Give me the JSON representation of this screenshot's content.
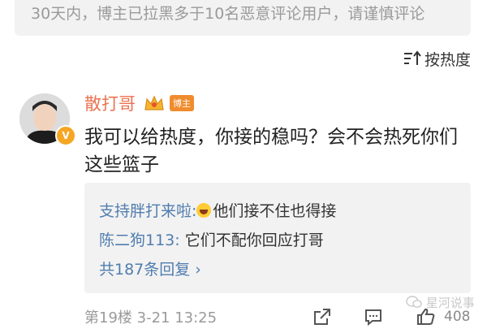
{
  "notice": {
    "text": "30天内，博主已拉黑多于10名恶意评论用户，请谨慎评论"
  },
  "sort": {
    "label": "按热度"
  },
  "comment": {
    "username": "散打哥",
    "tag": "博主",
    "text": "我可以给热度，你接的稳吗？会不会热死你们这些篮子",
    "floor": "第19楼",
    "time": "3-21 13:25",
    "likes": "408"
  },
  "replies": [
    {
      "name": "支持胖打来啦:",
      "text": "他们接不住也得接"
    },
    {
      "name": "陈二狗113:",
      "text": " 它们不配你回应打哥"
    }
  ],
  "replies_more": "共187条回复 ›",
  "watermark": "星河说事",
  "colors": {
    "name": "#eb7350",
    "link": "#507daf",
    "muted": "#9a9a9a"
  }
}
